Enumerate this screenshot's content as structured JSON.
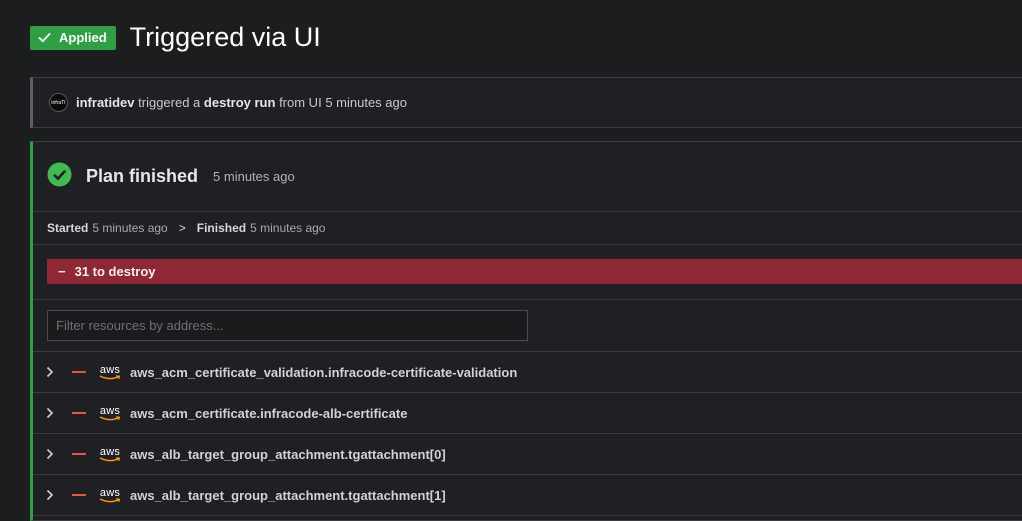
{
  "header": {
    "status_label": "Applied",
    "title": "Triggered via UI",
    "status_color": "#2ea043"
  },
  "trigger": {
    "avatar_text": "infraTI",
    "user": "infratidev",
    "text_triggered": "triggered a",
    "run_type": "destroy run",
    "text_from": "from UI",
    "time": "5 minutes ago"
  },
  "plan": {
    "title": "Plan finished",
    "time": "5 minutes ago",
    "started_label": "Started",
    "started_time": "5 minutes ago",
    "separator": ">",
    "finished_label": "Finished",
    "finished_time": "5 minutes ago",
    "destroy_symbol": "−",
    "destroy_summary": "31 to destroy",
    "destroy_color": "#8f2734"
  },
  "filter": {
    "placeholder": "Filter resources by address..."
  },
  "resources": [
    {
      "provider_icon": "aws-icon",
      "provider_text": "aws",
      "name": "aws_acm_certificate_validation.infracode-certificate-validation"
    },
    {
      "provider_icon": "aws-icon",
      "provider_text": "aws",
      "name": "aws_acm_certificate.infracode-alb-certificate"
    },
    {
      "provider_icon": "aws-icon",
      "provider_text": "aws",
      "name": "aws_alb_target_group_attachment.tgattachment[0]"
    },
    {
      "provider_icon": "aws-icon",
      "provider_text": "aws",
      "name": "aws_alb_target_group_attachment.tgattachment[1]"
    }
  ]
}
